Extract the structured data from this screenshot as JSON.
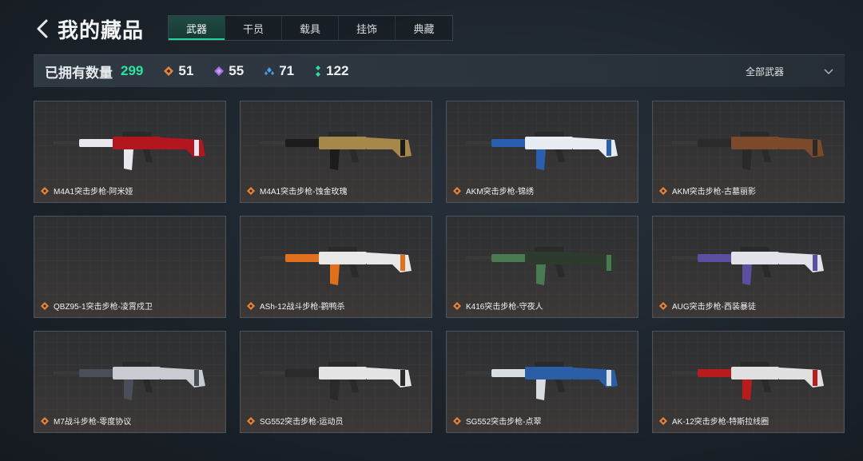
{
  "header": {
    "title": "我的藏品",
    "tabs": [
      {
        "label": "武器",
        "active": true
      },
      {
        "label": "干员",
        "active": false
      },
      {
        "label": "载具",
        "active": false
      },
      {
        "label": "挂饰",
        "active": false
      },
      {
        "label": "典藏",
        "active": false
      }
    ]
  },
  "stats": {
    "owned_label": "已拥有数量",
    "owned_count": "299",
    "tiers": [
      {
        "icon": "orange-diamond-icon",
        "color": "#e8843a",
        "count": "51"
      },
      {
        "icon": "purple-diamond-icon",
        "color": "#a66ce8",
        "count": "55"
      },
      {
        "icon": "blue-triple-icon",
        "color": "#4ba0e8",
        "count": "71"
      },
      {
        "icon": "green-dots-icon",
        "color": "#2ee39d",
        "count": "122"
      }
    ],
    "filter_label": "全部武器"
  },
  "items": [
    {
      "name": "M4A1突击步枪-阿米娅",
      "primary": "#b3161e",
      "secondary": "#e8e8ee",
      "empty": false
    },
    {
      "name": "M4A1突击步枪-蚀金玫瑰",
      "primary": "#a5884a",
      "secondary": "#1c1c1c",
      "empty": false
    },
    {
      "name": "AKM突击步枪-锦绣",
      "primary": "#e6ecf2",
      "secondary": "#2a5fb0",
      "empty": false
    },
    {
      "name": "AKM突击步枪-古墓丽影",
      "primary": "#7a4a2a",
      "secondary": "#2a2a2a",
      "empty": false
    },
    {
      "name": "QBZ95-1突击步枪-凌霄戍卫",
      "primary": "#3a3a3a",
      "secondary": "#555555",
      "empty": true
    },
    {
      "name": "ASh-12战斗步枪-鹳鸭杀",
      "primary": "#e8e8e8",
      "secondary": "#e0701e",
      "empty": false
    },
    {
      "name": "K416突击步枪-守夜人",
      "primary": "#2d3a2e",
      "secondary": "#4a7a52",
      "empty": false
    },
    {
      "name": "AUG突击步枪-西装暴徒",
      "primary": "#e2e2ea",
      "secondary": "#5a4fa0",
      "empty": false
    },
    {
      "name": "M7战斗步枪-零度协议",
      "primary": "#c8ccd2",
      "secondary": "#4a4e58",
      "empty": false
    },
    {
      "name": "SG552突击步枪-运动员",
      "primary": "#e4e4e4",
      "secondary": "#2a2a2a",
      "empty": false
    },
    {
      "name": "SG552突击步枪-点翠",
      "primary": "#2a5fa8",
      "secondary": "#d8dde2",
      "empty": false
    },
    {
      "name": "AK-12突击步枪-特斯拉线圈",
      "primary": "#e0e0e0",
      "secondary": "#b81c1c",
      "empty": false
    }
  ]
}
